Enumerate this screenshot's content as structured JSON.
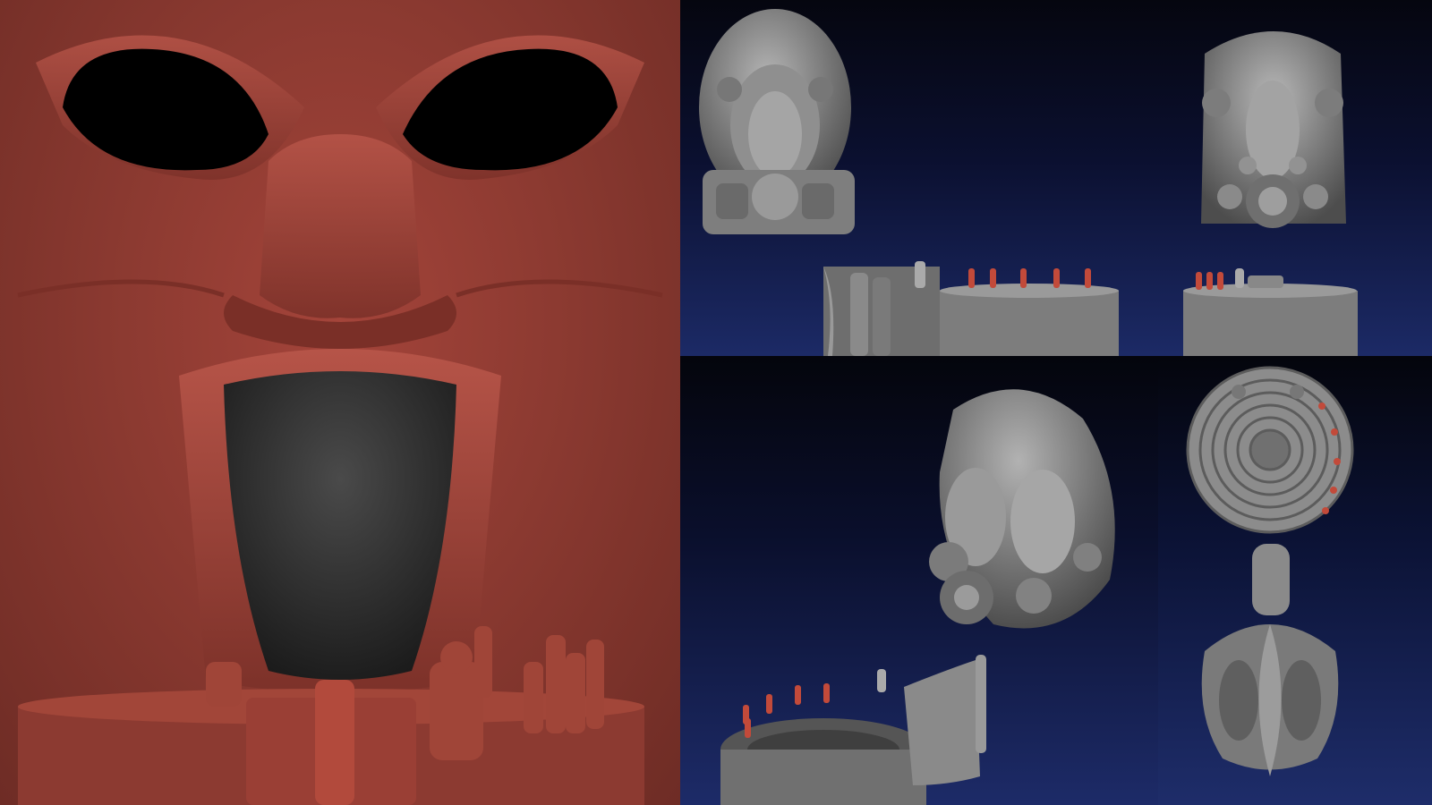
{
  "viewport": {
    "name": "sculpt-viewport-collage"
  },
  "colors": {
    "clay_red": "#9a3f35",
    "clay_red_dark": "#6e2c25",
    "clay_gray": "#8a8a8a",
    "clay_gray_dark": "#4e4e4e",
    "viewport_blue": "#1c2a66",
    "viewport_black": "#05060f",
    "candle_red": "#b24a3c"
  },
  "panels": [
    {
      "id": "mask",
      "content": "red-clay-mask-sculpt"
    },
    {
      "id": "top-left",
      "content": "helmet-head-front-view"
    },
    {
      "id": "top-right",
      "content": "ornate-head-front-view"
    },
    {
      "id": "bottom-left",
      "content": "helmet-head-three-quarter-view"
    },
    {
      "id": "bottom-right",
      "content": "top-down-platform-view"
    }
  ]
}
